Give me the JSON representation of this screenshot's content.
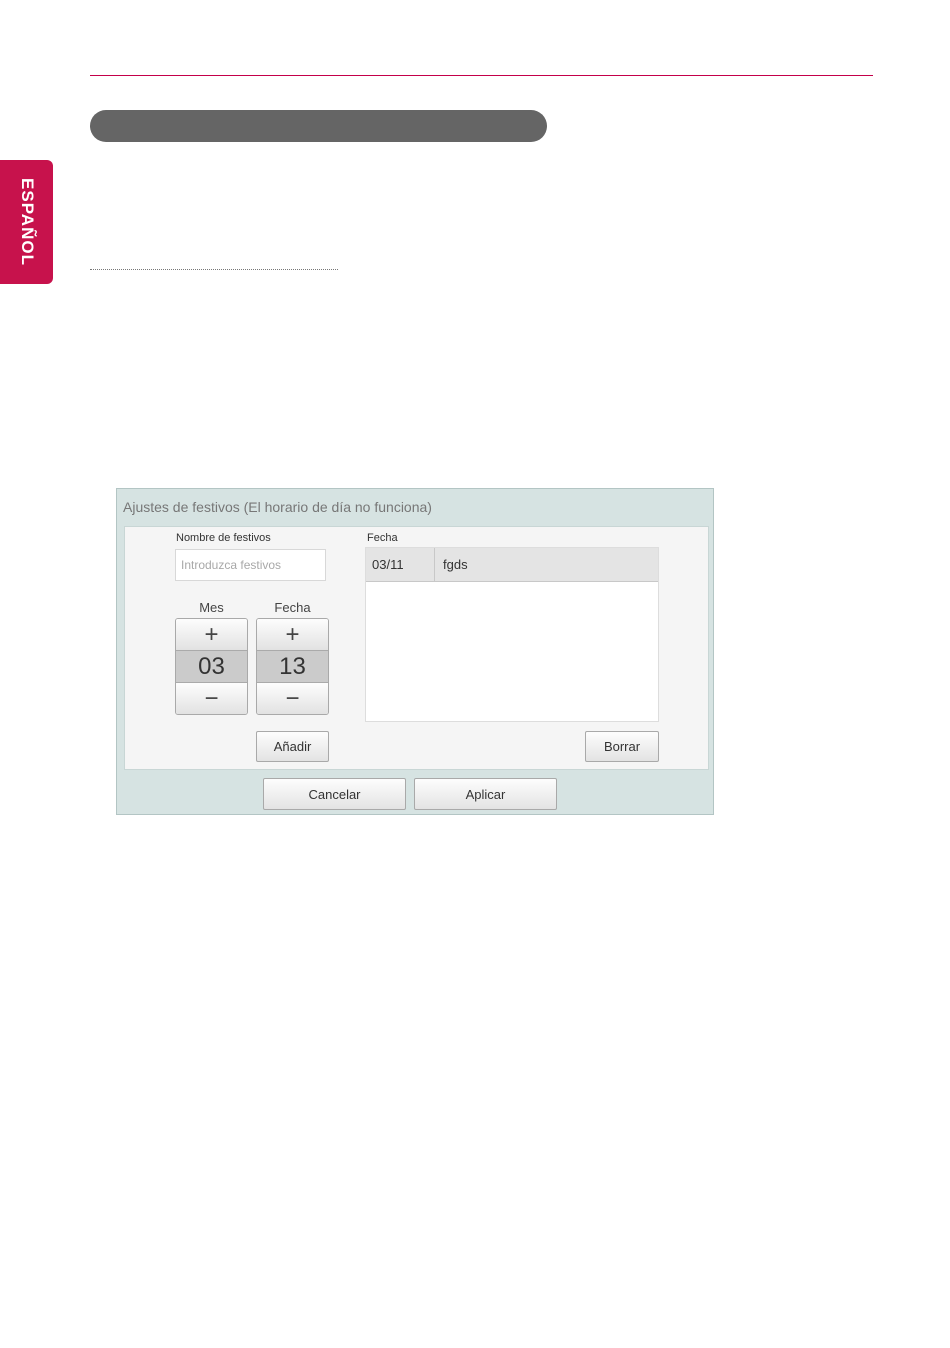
{
  "side_tab": {
    "label": "ESPAÑOL"
  },
  "dialog": {
    "title": "Ajustes de festivos (El horario de día no funciona)",
    "name_label": "Nombre de festivos",
    "name_placeholder": "Introduzca festivos",
    "month_label": "Mes",
    "day_label": "Fecha",
    "plus_symbol": "+",
    "minus_symbol": "−",
    "month_value": "03",
    "day_value": "13",
    "add_button": "Añadir",
    "list_label": "Fecha",
    "list_rows": [
      {
        "date": "03/11",
        "name": "fgds"
      }
    ],
    "delete_button": "Borrar",
    "cancel_button": "Cancelar",
    "apply_button": "Aplicar"
  }
}
